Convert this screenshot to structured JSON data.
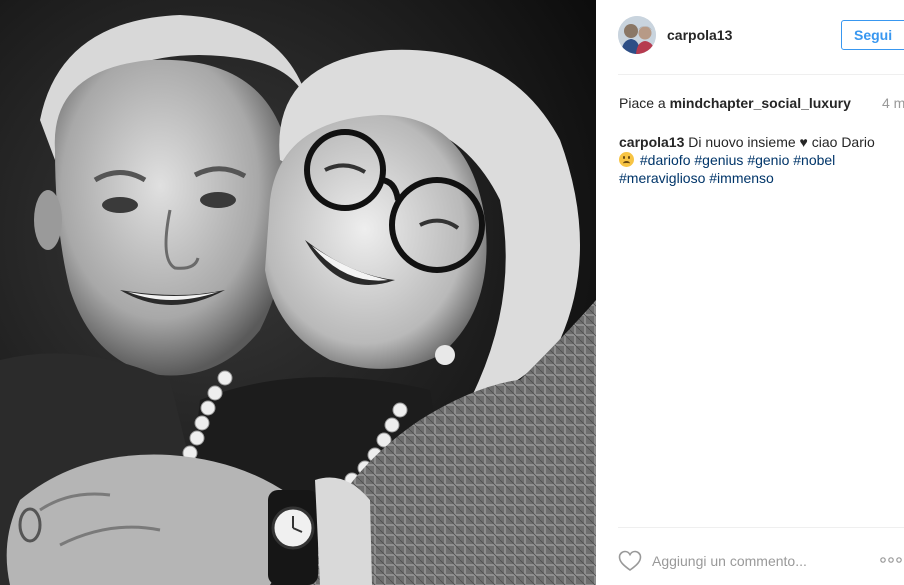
{
  "post": {
    "photo_icon": "photo-portrait",
    "author": {
      "username": "carpola13",
      "avatar_icon": "avatar-photo"
    },
    "follow_label": "Segui",
    "likes": {
      "prefix": "Piace a ",
      "user": "mindchapter_social_luxury"
    },
    "time_ago": "4 m",
    "caption": {
      "user": "carpola13",
      "text_before": "Di nuovo insieme",
      "heart": "♥",
      "text_after": "ciao Dario",
      "hashtags": [
        "#dariofo",
        "#genius",
        "#genio",
        "#nobel",
        "#meraviglioso",
        "#immenso"
      ]
    },
    "comment_placeholder": "Aggiungi un commento...",
    "icons": {
      "like": "heart-outline-icon",
      "more": "more-options-icon",
      "emoji": "disappointed-face-emoji"
    }
  },
  "colors": {
    "link_blue": "#3897f0",
    "hashtag": "#003569",
    "muted": "#999999"
  }
}
